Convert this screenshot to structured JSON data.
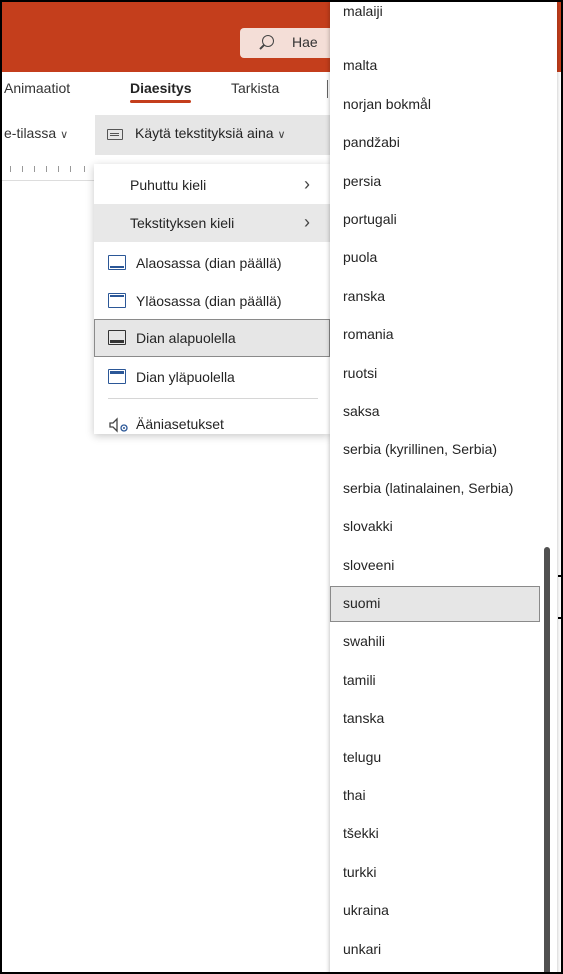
{
  "titlebar": {
    "color": "#c43e1c",
    "search_label": "Hae"
  },
  "ribbon_tabs": [
    "Animaatiot",
    "Diaesitys",
    "Tarkista"
  ],
  "active_tab_index": 1,
  "toolbar": {
    "left_label": "e-tilassa",
    "subtitle_button_label": "Käytä tekstityksiä aina"
  },
  "menu": {
    "spoken_language": "Puhuttu kieli",
    "subtitle_language": "Tekstityksen kieli",
    "bottom_overlay": "Alaosassa (dian päällä)",
    "top_overlay": "Yläosassa (dian päällä)",
    "below_slide": "Dian alapuolella",
    "above_slide": "Dian yläpuolella",
    "audio_settings": "Ääniasetukset"
  },
  "languages": [
    "malaiji",
    "malta",
    "norjan bokmål",
    "pandžabi",
    "persia",
    "portugali",
    "puola",
    "ranska",
    "romania",
    "ruotsi",
    "saksa",
    "serbia (kyrillinen, Serbia)",
    "serbia (latinalainen, Serbia)",
    "slovakki",
    "sloveeni",
    "suomi",
    "swahili",
    "tamili",
    "tanska",
    "telugu",
    "thai",
    "tšekki",
    "turkki",
    "ukraina",
    "unkari"
  ],
  "selected_language_index": 15
}
